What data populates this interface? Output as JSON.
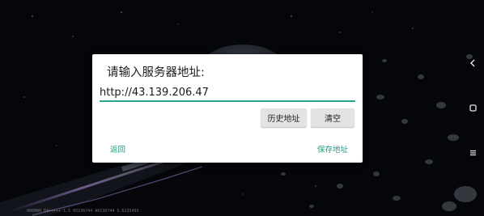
{
  "dialog": {
    "title": "请输入服务器地址:",
    "url_value": "http://43.139.206.47",
    "history_label": "历史地址",
    "clear_label": "清空",
    "back_label": "返回",
    "save_label": "保存地址"
  },
  "background": {
    "watermark": "000000 DA+++++ 1.5  05136744  A6136744  5.6135493"
  },
  "nav": {
    "back_icon": "chevron-left-icon",
    "home_icon": "square-icon",
    "menu_icon": "menu-icon"
  },
  "colors": {
    "accent": "#2aa58f",
    "dialog_bg": "#ffffff",
    "button_bg": "#e3e3e3"
  }
}
